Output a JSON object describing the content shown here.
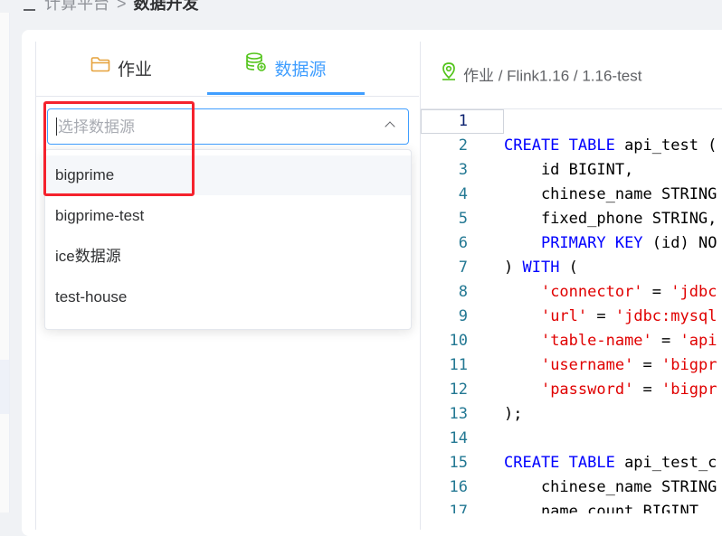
{
  "breadcrumb": {
    "parent": "计算平台",
    "separator": ">",
    "current": "数据开发"
  },
  "tabs": [
    {
      "label": "作业",
      "icon": "folder-icon",
      "active": false
    },
    {
      "label": "数据源",
      "icon": "database-icon",
      "active": true
    }
  ],
  "colors": {
    "accent": "#409eff",
    "highlight_box": "#f5222d",
    "keyword": "#0000ff",
    "string": "#e00000"
  },
  "select": {
    "placeholder": "选择数据源",
    "value": ""
  },
  "dropdown": {
    "options": [
      "bigprime",
      "bigprime-test",
      "ice数据源",
      "test-house"
    ],
    "hovered_index": 0
  },
  "editor": {
    "path": "作业 / Flink1.16 / 1.16-test",
    "line_numbers": [
      "1",
      "2",
      "3",
      "4",
      "5",
      "6",
      "7",
      "8",
      "9",
      "10",
      "11",
      "12",
      "13",
      "14",
      "15",
      "16",
      "17"
    ],
    "active_line": 1,
    "lines": [
      [],
      [
        [
          "kw",
          "CREATE TABLE"
        ],
        [
          "t",
          " api_test ("
        ]
      ],
      [
        [
          "t",
          "    id BIGINT,"
        ]
      ],
      [
        [
          "t",
          "    chinese_name STRING"
        ]
      ],
      [
        [
          "t",
          "    fixed_phone STRING,"
        ]
      ],
      [
        [
          "t",
          "    "
        ],
        [
          "kw",
          "PRIMARY KEY"
        ],
        [
          "t",
          " (id) NO"
        ]
      ],
      [
        [
          "t",
          ") "
        ],
        [
          "kw",
          "WITH"
        ],
        [
          "t",
          " ("
        ]
      ],
      [
        [
          "t",
          "    "
        ],
        [
          "red",
          "'connector'"
        ],
        [
          "t",
          " = "
        ],
        [
          "red",
          "'jdbc"
        ]
      ],
      [
        [
          "t",
          "    "
        ],
        [
          "red",
          "'url'"
        ],
        [
          "t",
          " = "
        ],
        [
          "red",
          "'jdbc:mysql"
        ]
      ],
      [
        [
          "t",
          "    "
        ],
        [
          "red",
          "'table-name'"
        ],
        [
          "t",
          " = "
        ],
        [
          "red",
          "'api"
        ]
      ],
      [
        [
          "t",
          "    "
        ],
        [
          "red",
          "'username'"
        ],
        [
          "t",
          " = "
        ],
        [
          "red",
          "'bigpr"
        ]
      ],
      [
        [
          "t",
          "    "
        ],
        [
          "red",
          "'password'"
        ],
        [
          "t",
          " = "
        ],
        [
          "red",
          "'bigpr"
        ]
      ],
      [
        [
          "t",
          ");"
        ]
      ],
      [],
      [
        [
          "kw",
          "CREATE TABLE"
        ],
        [
          "t",
          " api_test_c"
        ]
      ],
      [
        [
          "t",
          "    chinese_name STRING"
        ]
      ],
      [
        [
          "t",
          "    name_count BIGINT"
        ]
      ]
    ]
  }
}
